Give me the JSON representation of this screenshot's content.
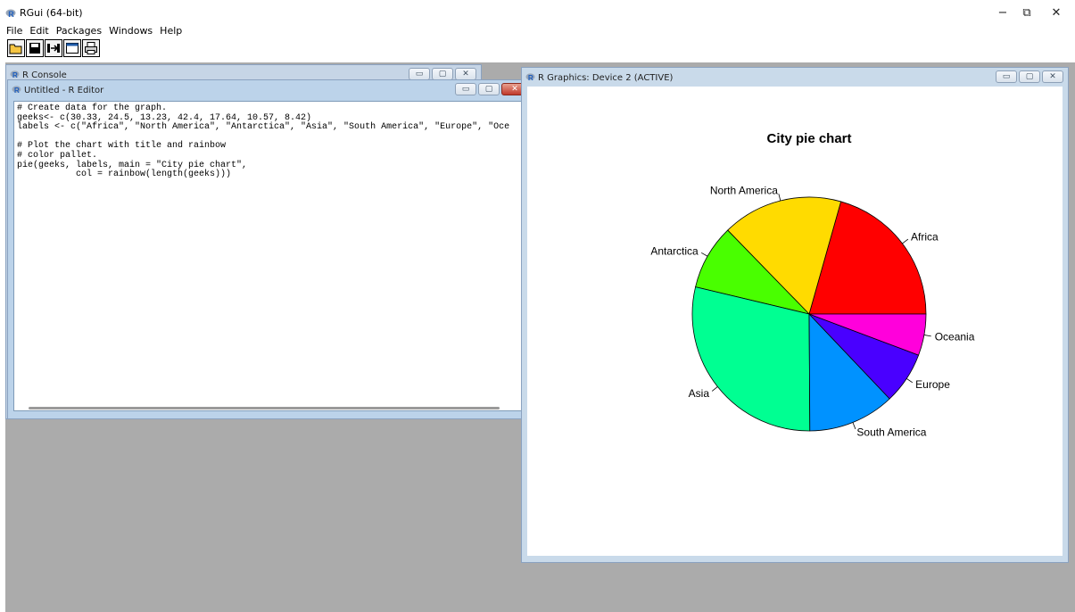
{
  "app": {
    "title": "RGui (64-bit)"
  },
  "window_controls": {
    "minimize": "−",
    "restore": "⧉",
    "close": "✕"
  },
  "menubar": {
    "items": [
      "File",
      "Edit",
      "Packages",
      "Windows",
      "Help"
    ]
  },
  "toolbar": {
    "icons": [
      "open-script-icon",
      "save-icon",
      "load-workspace-icon",
      "window-icon",
      "print-icon"
    ]
  },
  "console": {
    "title": "R Console"
  },
  "editor": {
    "title": "Untitled - R Editor",
    "lines": [
      "# Create data for the graph.",
      "geeks<- c(30.33, 24.5, 13.23, 42.4, 17.64, 10.57, 8.42)",
      "labels <- c(\"Africa\", \"North America\", \"Antarctica\", \"Asia\", \"South America\", \"Europe\", \"Oce",
      "",
      "# Plot the chart with title and rainbow",
      "# color pallet.",
      "pie(geeks, labels, main = \"City pie chart\",",
      "           col = rainbow(length(geeks)))"
    ]
  },
  "graphics": {
    "title": "R Graphics: Device 2 (ACTIVE)"
  },
  "chart_data": {
    "type": "pie",
    "title": "City pie chart",
    "categories": [
      "Africa",
      "North America",
      "Antarctica",
      "Asia",
      "South America",
      "Europe",
      "Oceania"
    ],
    "values": [
      30.33,
      24.5,
      13.23,
      42.4,
      17.64,
      10.57,
      8.42
    ],
    "colors": [
      "#FF0000",
      "#FFDB00",
      "#49FF00",
      "#00FF92",
      "#0092FF",
      "#4900FF",
      "#FF00DB"
    ],
    "start": "3 o'clock",
    "direction": "counter-clockwise"
  }
}
